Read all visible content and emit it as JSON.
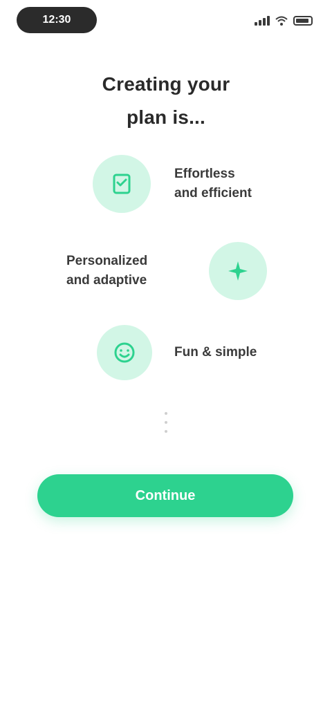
{
  "status_bar": {
    "time": "12:30"
  },
  "header": {
    "title_line1": "Creating your",
    "title_line2": "plan is..."
  },
  "features": [
    {
      "label_line1": "Effortless",
      "label_line2": "and efficient",
      "icon": "checklist-icon"
    },
    {
      "label_line1": "Personalized",
      "label_line2": "and adaptive",
      "icon": "sparkle-icon"
    },
    {
      "label_line1": "Fun & simple",
      "label_line2": "",
      "icon": "smile-icon"
    }
  ],
  "cta": {
    "label": "Continue"
  },
  "colors": {
    "accent": "#2dd28f",
    "accent_soft": "#d2f6e6",
    "text": "#2a2a2a"
  }
}
